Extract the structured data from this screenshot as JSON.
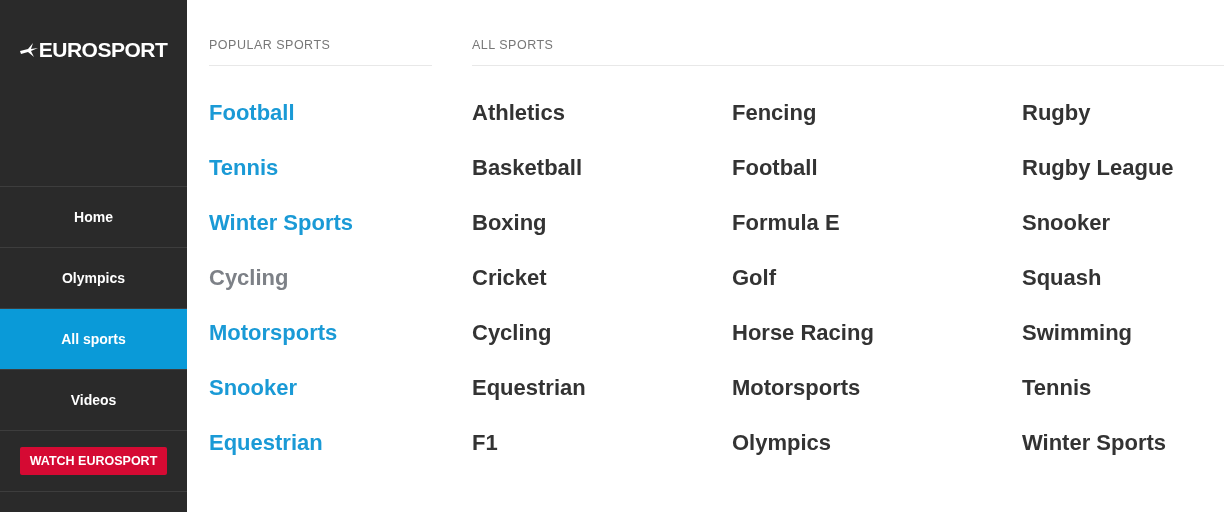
{
  "sidebar": {
    "logo": "EUROSPORT",
    "items": [
      {
        "label": "Home",
        "selected": false
      },
      {
        "label": "Olympics",
        "selected": false
      },
      {
        "label": "All sports",
        "selected": true
      },
      {
        "label": "Videos",
        "selected": false
      }
    ],
    "cta": "WATCH EUROSPORT"
  },
  "popular_sports": {
    "heading": "POPULAR SPORTS",
    "items": [
      {
        "label": "Football",
        "muted": false
      },
      {
        "label": "Tennis",
        "muted": false
      },
      {
        "label": "Winter Sports",
        "muted": false
      },
      {
        "label": "Cycling",
        "muted": true
      },
      {
        "label": "Motorsports",
        "muted": false
      },
      {
        "label": "Snooker",
        "muted": false
      },
      {
        "label": "Equestrian",
        "muted": false
      }
    ]
  },
  "all_sports": {
    "heading": "ALL SPORTS",
    "columns": [
      [
        "Athletics",
        "Basketball",
        "Boxing",
        "Cricket",
        "Cycling",
        "Equestrian",
        "F1"
      ],
      [
        "Fencing",
        "Football",
        "Formula E",
        "Golf",
        "Horse Racing",
        "Motorsports",
        "Olympics"
      ],
      [
        "Rugby",
        "Rugby League",
        "Snooker",
        "Squash",
        "Swimming",
        "Tennis",
        "Winter Sports"
      ]
    ]
  }
}
